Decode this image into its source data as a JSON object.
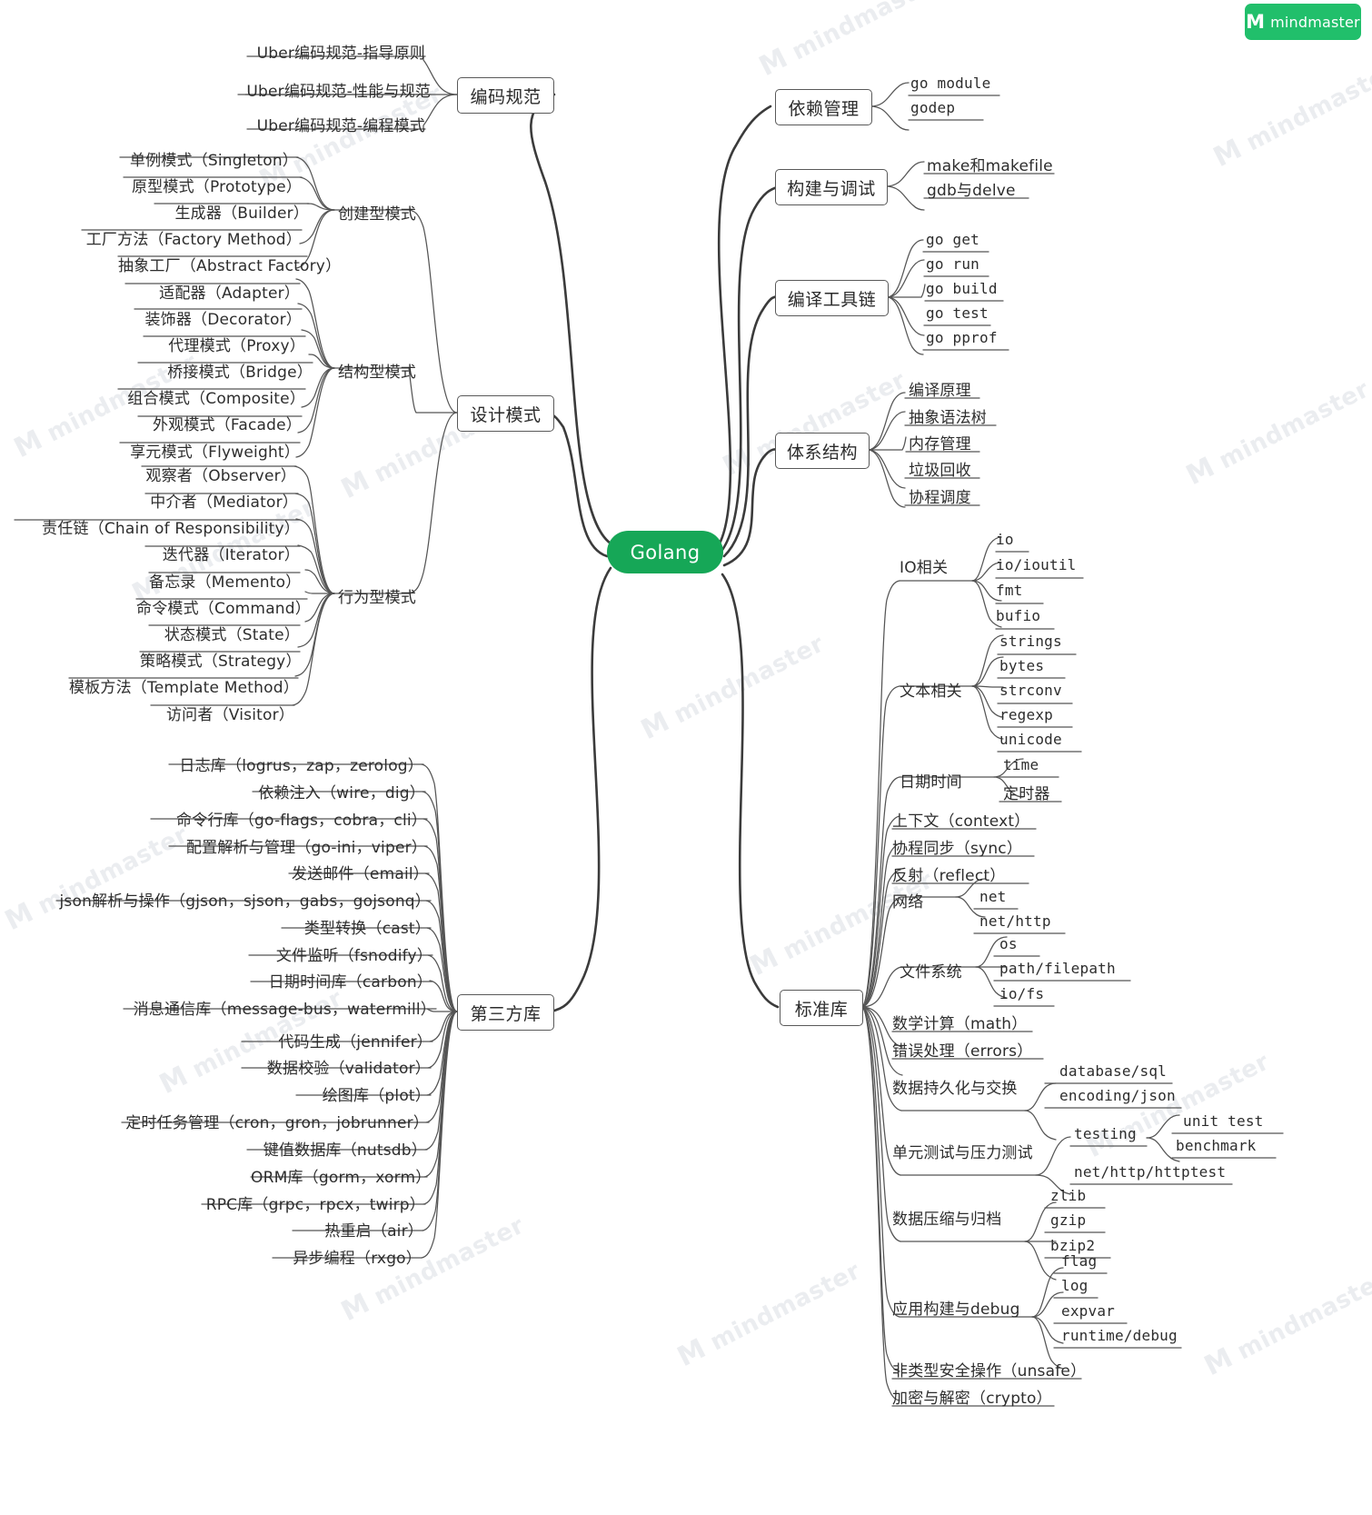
{
  "brand": {
    "name": "mindmaster",
    "mark": "M",
    "color": "#21bf6b"
  },
  "watermark": {
    "text": "mindmaster"
  },
  "root": {
    "label": "Golang",
    "color": "#16a757"
  },
  "left_branches": [
    {
      "label": "编码规范",
      "children": [
        {
          "label": "Uber编码规范-指导原则"
        },
        {
          "label": "Uber编码规范-性能与规范"
        },
        {
          "label": "Uber编码规范-编程模式"
        }
      ]
    },
    {
      "label": "设计模式",
      "groups": [
        {
          "label": "创建型模式",
          "items": [
            "单例模式（Singleton）",
            "原型模式（Prototype）",
            "生成器（Builder）",
            "工厂方法（Factory Method）",
            "抽象工厂（Abstract Factory）"
          ]
        },
        {
          "label": "结构型模式",
          "items": [
            "适配器（Adapter）",
            "装饰器（Decorator）",
            "代理模式（Proxy）",
            "桥接模式（Bridge）",
            "组合模式（Composite）",
            "外观模式（Facade）",
            "享元模式（Flyweight）"
          ]
        },
        {
          "label": "行为型模式",
          "items": [
            "观察者（Observer）",
            "中介者（Mediator）",
            "责任链（Chain of Responsibility）",
            "迭代器（Iterator）",
            "备忘录（Memento）",
            "命令模式（Command）",
            "状态模式（State）",
            "策略模式（Strategy）",
            "模板方法（Template Method）",
            "访问者（Visitor）"
          ]
        }
      ]
    },
    {
      "label": "第三方库",
      "children": [
        {
          "label": "日志库（logrus，zap，zerolog）"
        },
        {
          "label": "依赖注入（wire，dig）"
        },
        {
          "label": "命令行库（go-flags，cobra，cli）"
        },
        {
          "label": "配置解析与管理（go-ini，viper）"
        },
        {
          "label": "发送邮件（email）"
        },
        {
          "label": "json解析与操作（gjson，sjson，gabs，gojsonq）"
        },
        {
          "label": "类型转换（cast）"
        },
        {
          "label": "文件监听（fsnodify）"
        },
        {
          "label": "日期时间库（carbon）"
        },
        {
          "label": "消息通信库（message-bus，watermill）"
        },
        {
          "label": "代码生成（jennifer）"
        },
        {
          "label": "数据校验（validator）"
        },
        {
          "label": "绘图库（plot）"
        },
        {
          "label": "定时任务管理（cron，gron，jobrunner）"
        },
        {
          "label": "键值数据库（nutsdb）"
        },
        {
          "label": "ORM库（gorm，xorm）"
        },
        {
          "label": "RPC库（grpc，rpcx，twirp）"
        },
        {
          "label": "热重启（air）"
        },
        {
          "label": "异步编程（rxgo）"
        }
      ]
    }
  ],
  "right_branches": [
    {
      "label": "依赖管理",
      "children": [
        {
          "label": "go module"
        },
        {
          "label": "godep"
        }
      ]
    },
    {
      "label": "构建与调试",
      "children": [
        {
          "label": "make和makefile"
        },
        {
          "label": "gdb与delve"
        }
      ]
    },
    {
      "label": "编译工具链",
      "children": [
        {
          "label": "go get"
        },
        {
          "label": "go run"
        },
        {
          "label": "go build"
        },
        {
          "label": "go test"
        },
        {
          "label": "go pprof"
        }
      ]
    },
    {
      "label": "体系结构",
      "children": [
        {
          "label": "编译原理"
        },
        {
          "label": "抽象语法树"
        },
        {
          "label": "内存管理"
        },
        {
          "label": "垃圾回收"
        },
        {
          "label": "协程调度"
        }
      ]
    },
    {
      "label": "标准库",
      "groups": [
        {
          "label": "IO相关",
          "items": [
            "io",
            "io/ioutil",
            "fmt",
            "bufio"
          ]
        },
        {
          "label": "文本相关",
          "items": [
            "strings",
            "bytes",
            "strconv",
            "regexp",
            "unicode"
          ]
        },
        {
          "label": "日期时间",
          "items": [
            "time",
            "定时器"
          ]
        },
        {
          "label": "上下文（context）",
          "items": []
        },
        {
          "label": "协程同步（sync）",
          "items": []
        },
        {
          "label": "反射（reflect）",
          "items": []
        },
        {
          "label": "网络",
          "items": [
            "net",
            "net/http"
          ]
        },
        {
          "label": "文件系统",
          "items": [
            "os",
            "path/filepath",
            "io/fs"
          ]
        },
        {
          "label": "数学计算（math）",
          "items": []
        },
        {
          "label": "错误处理（errors）",
          "items": []
        },
        {
          "label": "数据持久化与交换",
          "items": [
            "database/sql",
            "encoding/json"
          ]
        },
        {
          "label": "单元测试与压力测试",
          "items": [
            "testing",
            "net/http/httptest"
          ],
          "subitems": [
            "unit test",
            "benchmark"
          ]
        },
        {
          "label": "数据压缩与归档",
          "items": [
            "zlib",
            "gzip",
            "bzip2"
          ]
        },
        {
          "label": "应用构建与debug",
          "items": [
            "flag",
            "log",
            "expvar",
            "runtime/debug"
          ]
        },
        {
          "label": "非类型安全操作（unsafe）",
          "items": []
        },
        {
          "label": "加密与解密（crypto）",
          "items": []
        }
      ]
    }
  ]
}
